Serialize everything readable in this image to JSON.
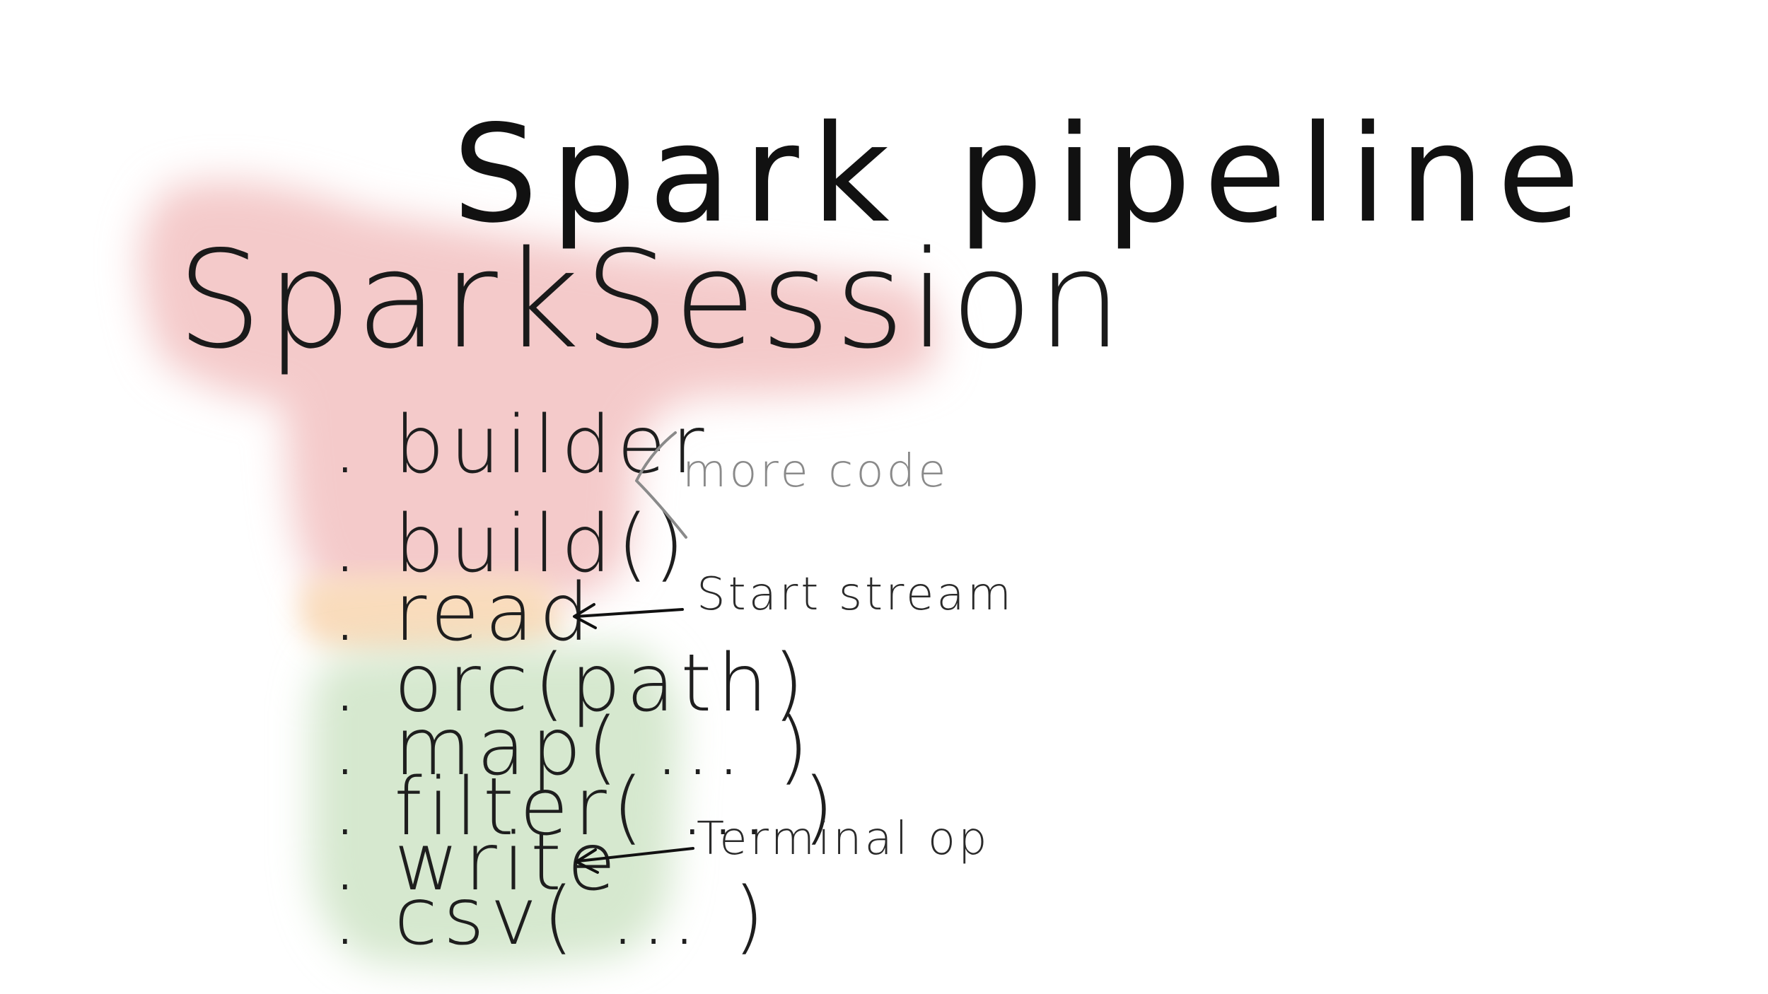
{
  "title": "Spark pipeline",
  "session": "SparkSession",
  "code_lines": [
    ". builder",
    ". build()",
    ". read",
    ". orc(path)",
    ". map( ... )",
    ". filter( ... )",
    ". write",
    ". csv( ... )"
  ],
  "annotations": {
    "more_code": "more code",
    "start_stream": "Start stream",
    "terminal_op": "Terminal op"
  },
  "highlight_colors": {
    "session_block": "#f4caca",
    "read_block": "#f9dcbc",
    "ops_block": "#d6e8cf"
  },
  "ink_colors": {
    "primary": "#111111",
    "gray_note": "#8a8a8a"
  }
}
